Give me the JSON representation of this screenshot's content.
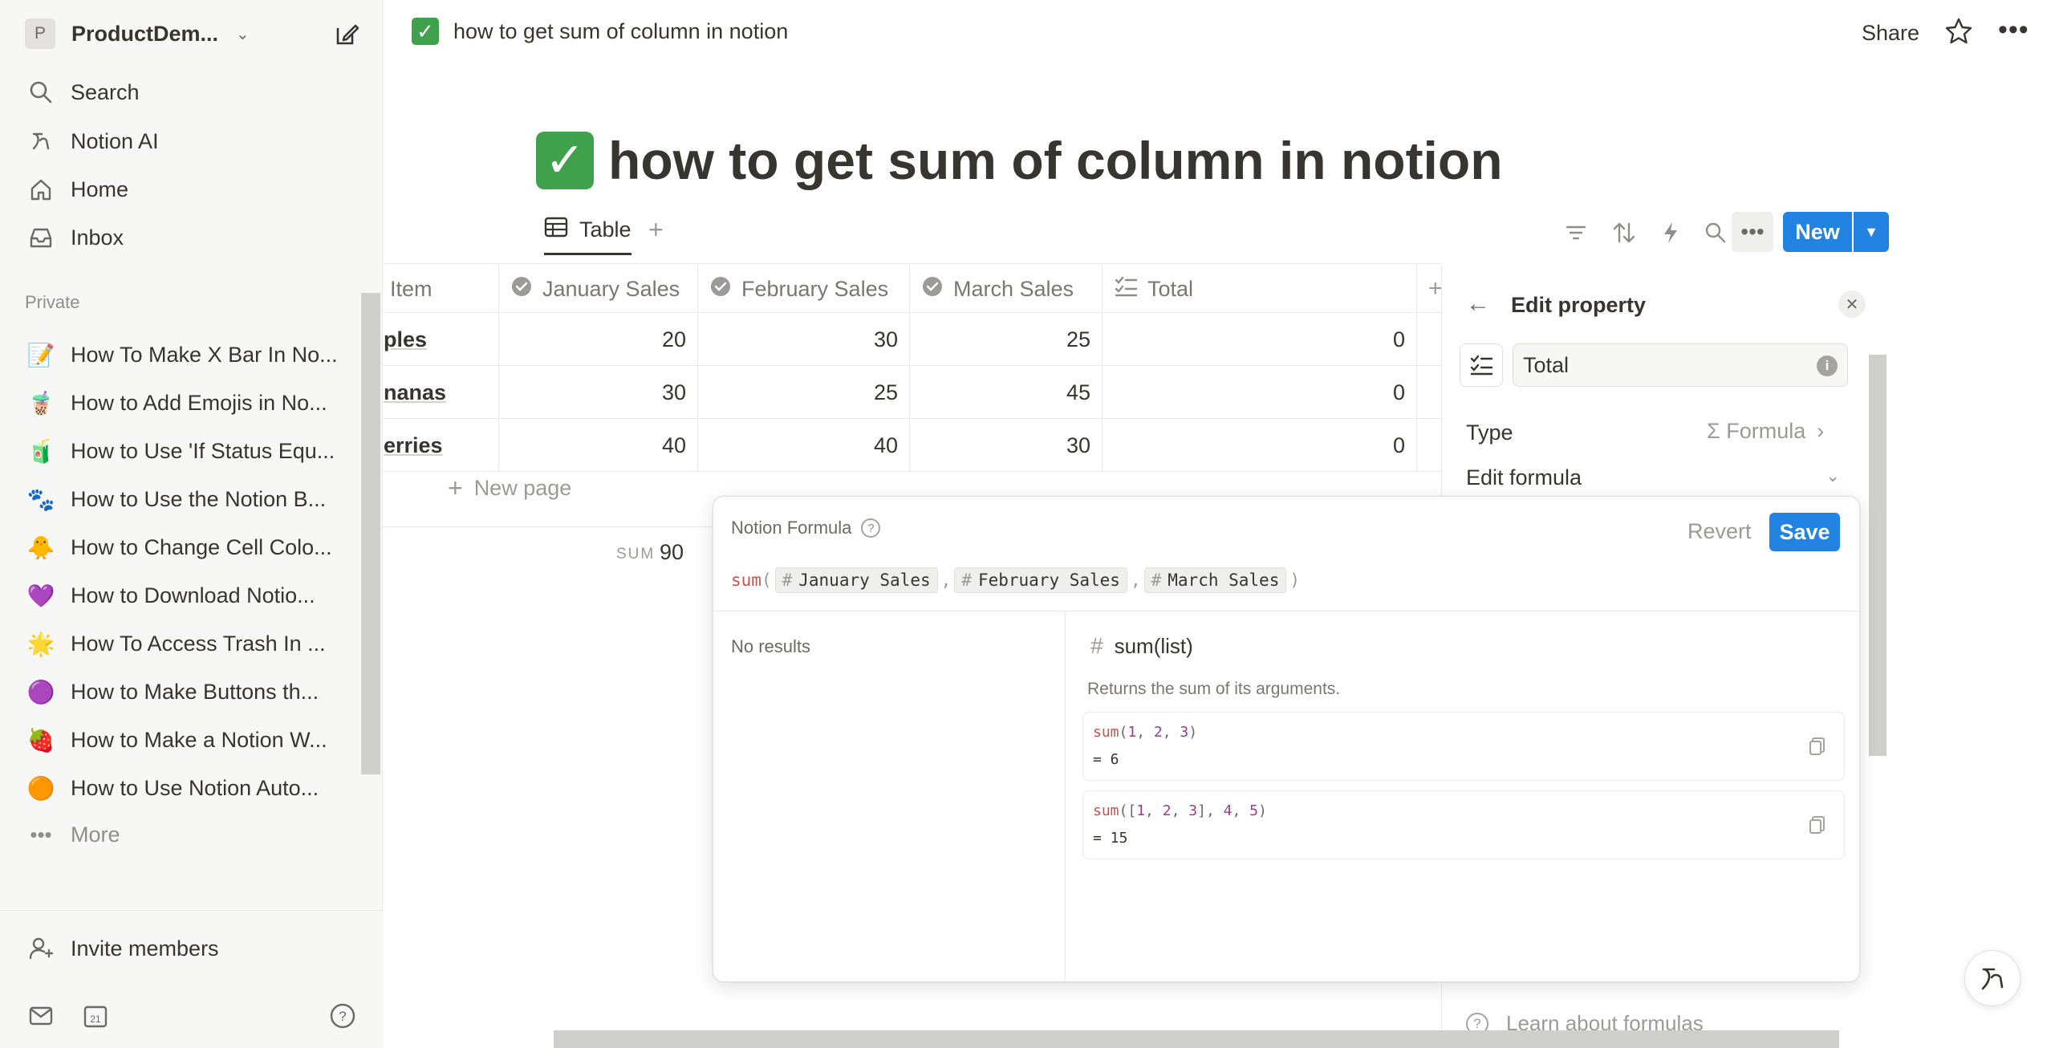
{
  "sidebar": {
    "workspace_initial": "P",
    "workspace_name": "ProductDem...",
    "nav": [
      {
        "label": "Search",
        "icon": "search-icon"
      },
      {
        "label": "Notion AI",
        "icon": "notion-ai-icon"
      },
      {
        "label": "Home",
        "icon": "home-icon"
      },
      {
        "label": "Inbox",
        "icon": "inbox-icon"
      }
    ],
    "section_label": "Private",
    "pages": [
      {
        "emoji": "📝",
        "label": "How To Make X Bar In No..."
      },
      {
        "emoji": "🧋",
        "label": "How to Add Emojis in No..."
      },
      {
        "emoji": "🧃",
        "label": "How to Use 'If Status Equ..."
      },
      {
        "emoji": "🐾",
        "label": "How to Use the Notion B..."
      },
      {
        "emoji": "🐥",
        "label": "How to Change Cell Colo..."
      },
      {
        "emoji": "💜",
        "label": "How to Download Notio..."
      },
      {
        "emoji": "🌟",
        "label": "How To Access Trash In ..."
      },
      {
        "emoji": "🟣",
        "label": "How to Make Buttons th..."
      },
      {
        "emoji": "🍓",
        "label": "How to Make a Notion W..."
      },
      {
        "emoji": "🟠",
        "label": "How to Use Notion Auto..."
      }
    ],
    "more_label": "More",
    "invite_label": "Invite members"
  },
  "topbar": {
    "breadcrumb": "how to get sum of column in notion",
    "share_label": "Share"
  },
  "page": {
    "title": "how to get sum of column in notion"
  },
  "database": {
    "view_label": "Table",
    "new_label": "New",
    "columns": [
      "Item",
      "January Sales",
      "February Sales",
      "March Sales",
      "Total"
    ],
    "rows": [
      {
        "item": "ples",
        "jan": "20",
        "feb": "30",
        "mar": "25",
        "total": "0"
      },
      {
        "item": "nanas",
        "jan": "30",
        "feb": "25",
        "mar": "45",
        "total": "0"
      },
      {
        "item": "erries",
        "jan": "40",
        "feb": "40",
        "mar": "30",
        "total": "0"
      }
    ],
    "new_page_label": "New page",
    "sum_label": "SUM",
    "sum_value": "90"
  },
  "edit_property": {
    "title": "Edit property",
    "name_value": "Total",
    "type_label": "Type",
    "type_value": "Formula",
    "edit_formula_label": "Edit formula",
    "learn_label": "Learn about formulas"
  },
  "formula_editor": {
    "header": "Notion Formula",
    "revert_label": "Revert",
    "save_label": "Save",
    "fn_name": "sum",
    "tokens": [
      "January Sales",
      "February Sales",
      "March Sales"
    ],
    "no_results": "No results",
    "signature": "sum(list)",
    "description": "Returns the sum of its arguments.",
    "example1_result": "= 6",
    "example2_result": "= 15"
  },
  "colors": {
    "accent": "#2383e2",
    "check_green": "#3fa14b",
    "sidebar_bg": "#f7f7f5",
    "formula_fn": "#c4554d"
  }
}
